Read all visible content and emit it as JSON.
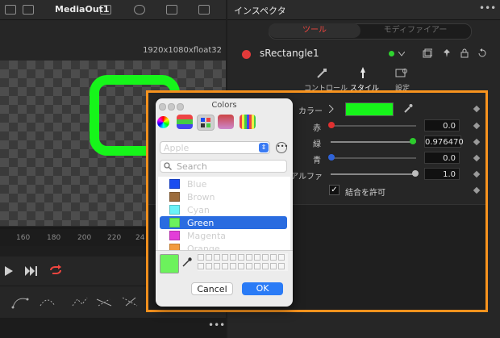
{
  "viewer": {
    "title": "MediaOut1",
    "resolution": "1920x1080xfloat32",
    "ruler_ticks": [
      "160",
      "180",
      "200",
      "220",
      "24"
    ]
  },
  "inspector": {
    "title": "インスペクタ",
    "tabs": [
      {
        "label": "ツール",
        "active": true
      },
      {
        "label": "モディファイアー",
        "active": false
      }
    ],
    "node_name": "sRectangle1",
    "subtabs": [
      "コントロール",
      "スタイル",
      "設定"
    ],
    "color_label": "カラー",
    "color_value": "#16f51a",
    "controls": [
      {
        "label": "赤",
        "value": "0.0",
        "level": 0.0,
        "knob_color": "#e03030"
      },
      {
        "label": "緑",
        "value": "0.976470",
        "level": 0.976,
        "knob_color": "#2ccc2c"
      },
      {
        "label": "青",
        "value": "0.0",
        "level": 0.0,
        "knob_color": "#2f63d9"
      },
      {
        "label": "アルファ",
        "value": "1.0",
        "level": 1.0,
        "knob_color": "#bdbdbd"
      }
    ],
    "checkbox": {
      "label": "結合を許可",
      "checked": true
    }
  },
  "colors_panel": {
    "title": "Colors",
    "palette": "Apple",
    "search_placeholder": "Search",
    "items": [
      {
        "name": "Blue",
        "color": "#1a4cf0",
        "selected": false
      },
      {
        "name": "Brown",
        "color": "#9c6c3c",
        "selected": false
      },
      {
        "name": "Cyan",
        "color": "#6af2f8",
        "selected": false
      },
      {
        "name": "Green",
        "color": "#6cf25c",
        "selected": true
      },
      {
        "name": "Magenta",
        "color": "#e33ed8",
        "selected": false
      },
      {
        "name": "Orange",
        "color": "#f29a3c",
        "selected": false
      }
    ],
    "cancel_label": "Cancel",
    "ok_label": "OK",
    "current_color": "#6cf25c"
  },
  "colors": {
    "highlight": "#f7931e",
    "accent_red": "#f0453f",
    "selection_blue": "#2a6ce0"
  }
}
